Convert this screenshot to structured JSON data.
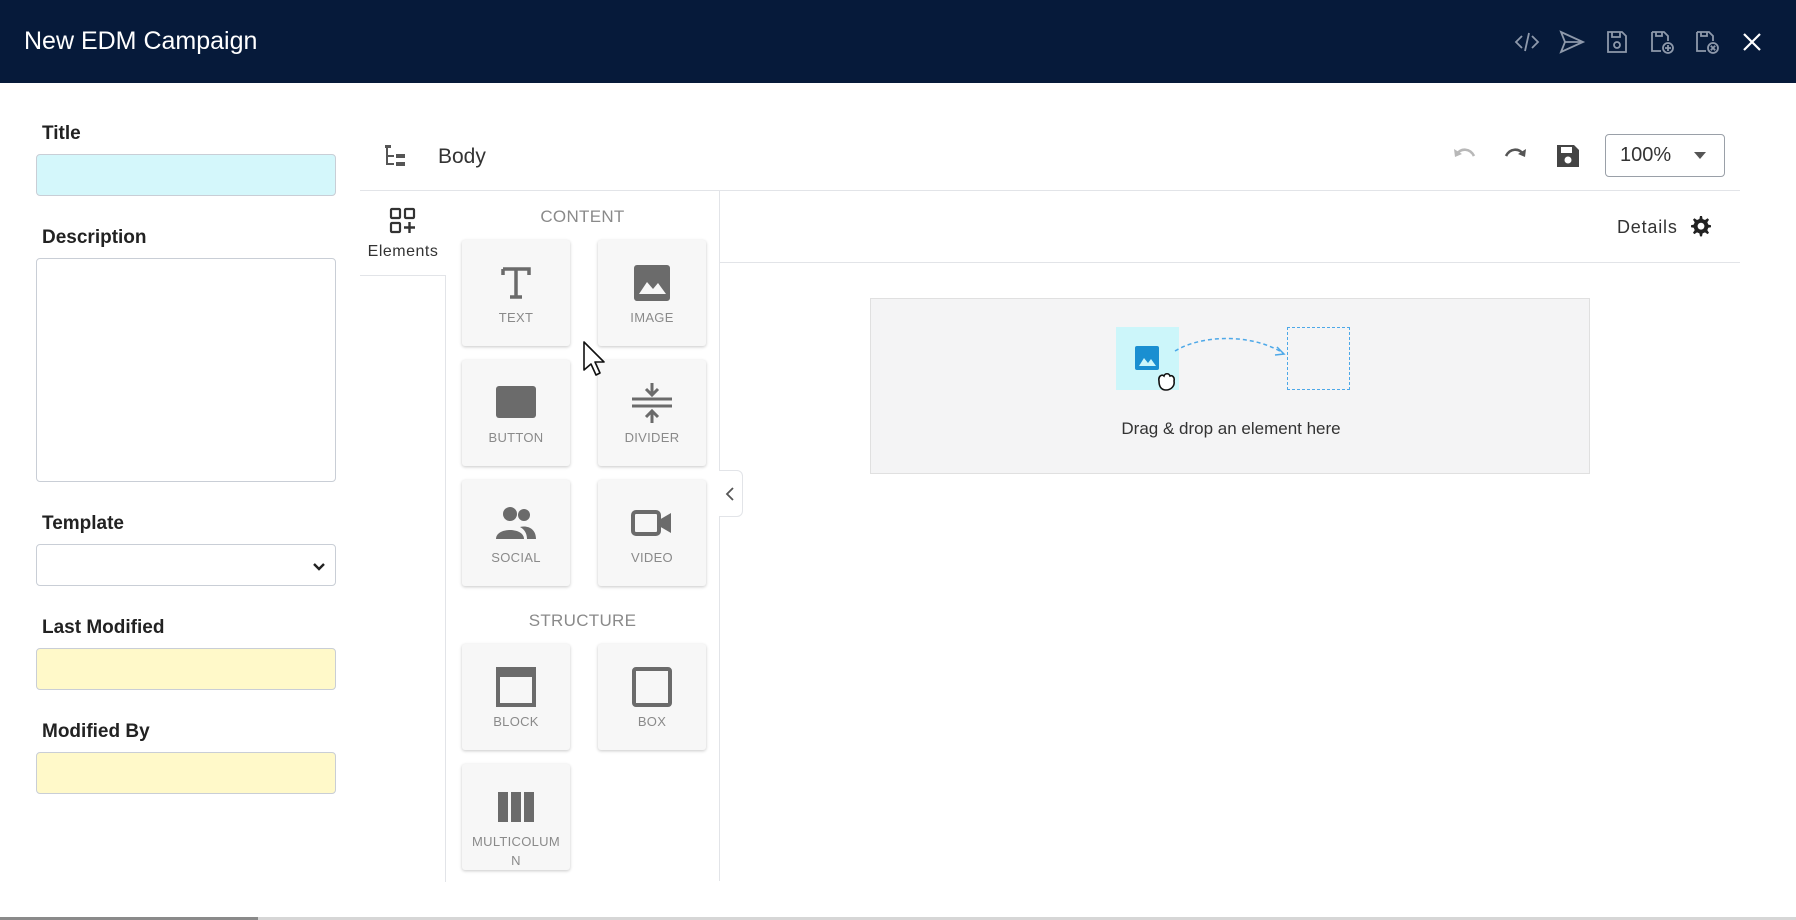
{
  "header": {
    "title": "New EDM Campaign",
    "actions": [
      {
        "icon": "code-icon"
      },
      {
        "icon": "send-icon"
      },
      {
        "icon": "save-icon"
      },
      {
        "icon": "save-add-icon"
      },
      {
        "icon": "save-close-icon"
      },
      {
        "icon": "close-icon"
      }
    ],
    "background": "#061a3a"
  },
  "form": {
    "title_label": "Title",
    "title_value": "",
    "description_label": "Description",
    "description_value": "",
    "template_label": "Template",
    "template_value": "",
    "last_modified_label": "Last Modified",
    "last_modified_value": "",
    "modified_by_label": "Modified By",
    "modified_by_value": ""
  },
  "editor": {
    "breadcrumb": "Body",
    "zoom": "100%",
    "side_tab_label": "Elements",
    "details_label": "Details",
    "content_section": "CONTENT",
    "structure_section": "STRUCTURE",
    "content_elements": [
      {
        "label": "TEXT",
        "icon": "text-icon"
      },
      {
        "label": "IMAGE",
        "icon": "image-icon"
      },
      {
        "label": "BUTTON",
        "icon": "button-icon"
      },
      {
        "label": "DIVIDER",
        "icon": "divider-icon"
      },
      {
        "label": "SOCIAL",
        "icon": "social-icon"
      },
      {
        "label": "VIDEO",
        "icon": "video-icon"
      }
    ],
    "structure_elements": [
      {
        "label": "BLOCK",
        "icon": "block-icon"
      },
      {
        "label": "BOX",
        "icon": "box-icon"
      },
      {
        "label": "MULTICOLUMN",
        "icon": "multicolumn-icon"
      }
    ],
    "drop_text": "Drag & drop an element here"
  },
  "colors": {
    "accent_input": "#d4f7fb",
    "readonly_input": "#fff9c9",
    "drop_illustration": "#1a8fd1"
  }
}
